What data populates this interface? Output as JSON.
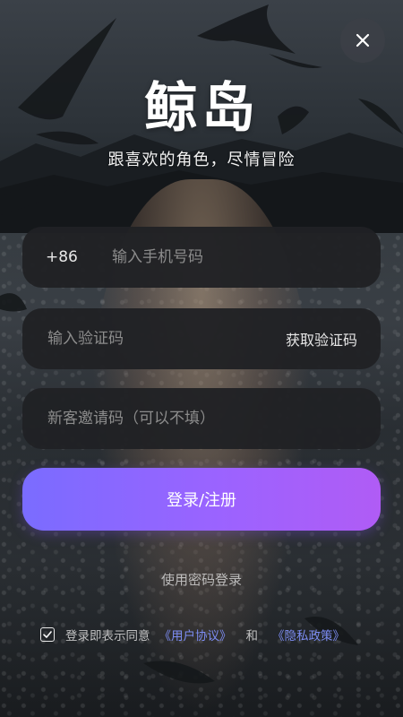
{
  "header": {
    "app_title": "鲸岛",
    "subtitle": "跟喜欢的角色，尽情冒险"
  },
  "icons": {
    "close": "close-icon",
    "checkbox": "check-icon"
  },
  "phone_field": {
    "country_code": "+86",
    "placeholder": "输入手机号码",
    "value": ""
  },
  "code_field": {
    "placeholder": "输入验证码",
    "value": "",
    "get_code_label": "获取验证码"
  },
  "invite_field": {
    "placeholder": "新客邀请码（可以不填）",
    "value": ""
  },
  "actions": {
    "submit_label": "登录/注册",
    "password_login_label": "使用密码登录"
  },
  "agreement": {
    "checked": true,
    "text": "登录即表示同意",
    "user_agreement_link": "《用户协议》",
    "and_text": "和",
    "privacy_policy_link": "《隐私政策》"
  },
  "colors": {
    "accent_gradient_start": "#7a6cff",
    "accent_gradient_end": "#b05cf5",
    "link": "#7c8cf2",
    "field_bg": "#202124"
  }
}
